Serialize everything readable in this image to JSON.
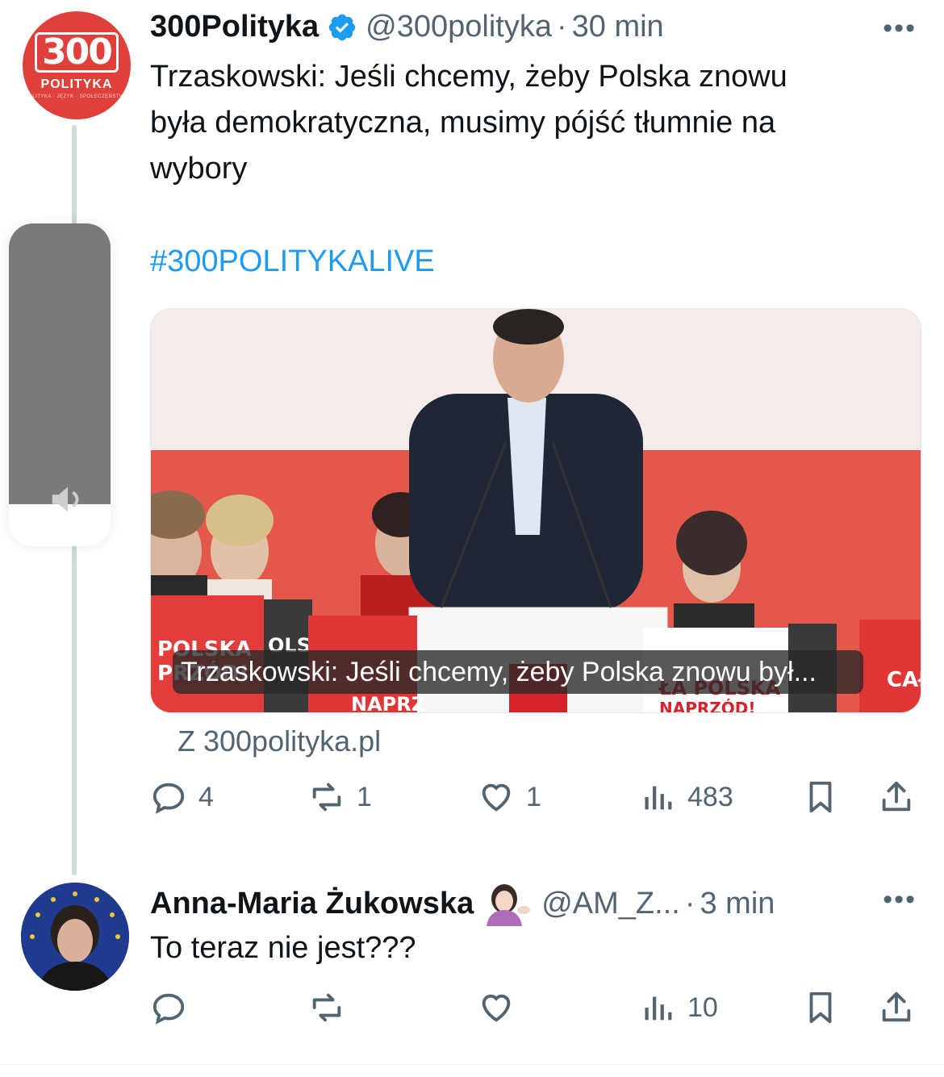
{
  "tweet1": {
    "avatar_label": "300",
    "avatar_sublabel": "POLITYKA",
    "avatar_tagline": "POLITYKA · JĘZYK · SPOŁECZEŃSTWO",
    "name": "300Polityka",
    "handle": "@300polityka",
    "separator": "·",
    "time": "30 min",
    "more": "•••",
    "text_line1": "Trzaskowski: Jeśli chcemy, żeby Polska znowu",
    "text_line2": "była demokratyczna, musimy pójść tłumnie na",
    "text_line3": "wybory",
    "hashtag": "#300POLITYKALIVE",
    "media": {
      "caption": "Trzaskowski: Jeśli chcemy, żeby Polska znowu był...",
      "sign_left": "POLSKA",
      "sign_left2": "PRZÓD!",
      "sign_mid": "NAPRZ",
      "sign_mid2": "OLS",
      "sign_right": "ŁA POLSKA",
      "sign_right2": "NAPRZÓD!",
      "sign_far_right": "CAŁ"
    },
    "source": "Z 300polityka.pl",
    "actions": {
      "replies": "4",
      "reposts": "1",
      "likes": "1",
      "views": "483"
    }
  },
  "tweet2": {
    "name": "Anna-Maria Żukowska",
    "handle": "@AM_Z...",
    "separator": "·",
    "time": "3 min",
    "more": "•••",
    "text": "To teraz nie jest???",
    "actions": {
      "replies": "",
      "reposts": "",
      "likes": "",
      "views": "10"
    }
  },
  "volume_overlay": {
    "level": 0.87,
    "icon": "speaker-icon"
  },
  "colors": {
    "accent": "#1d9bf0",
    "secondary_text": "#536471",
    "brand_red": "#e0403a"
  }
}
